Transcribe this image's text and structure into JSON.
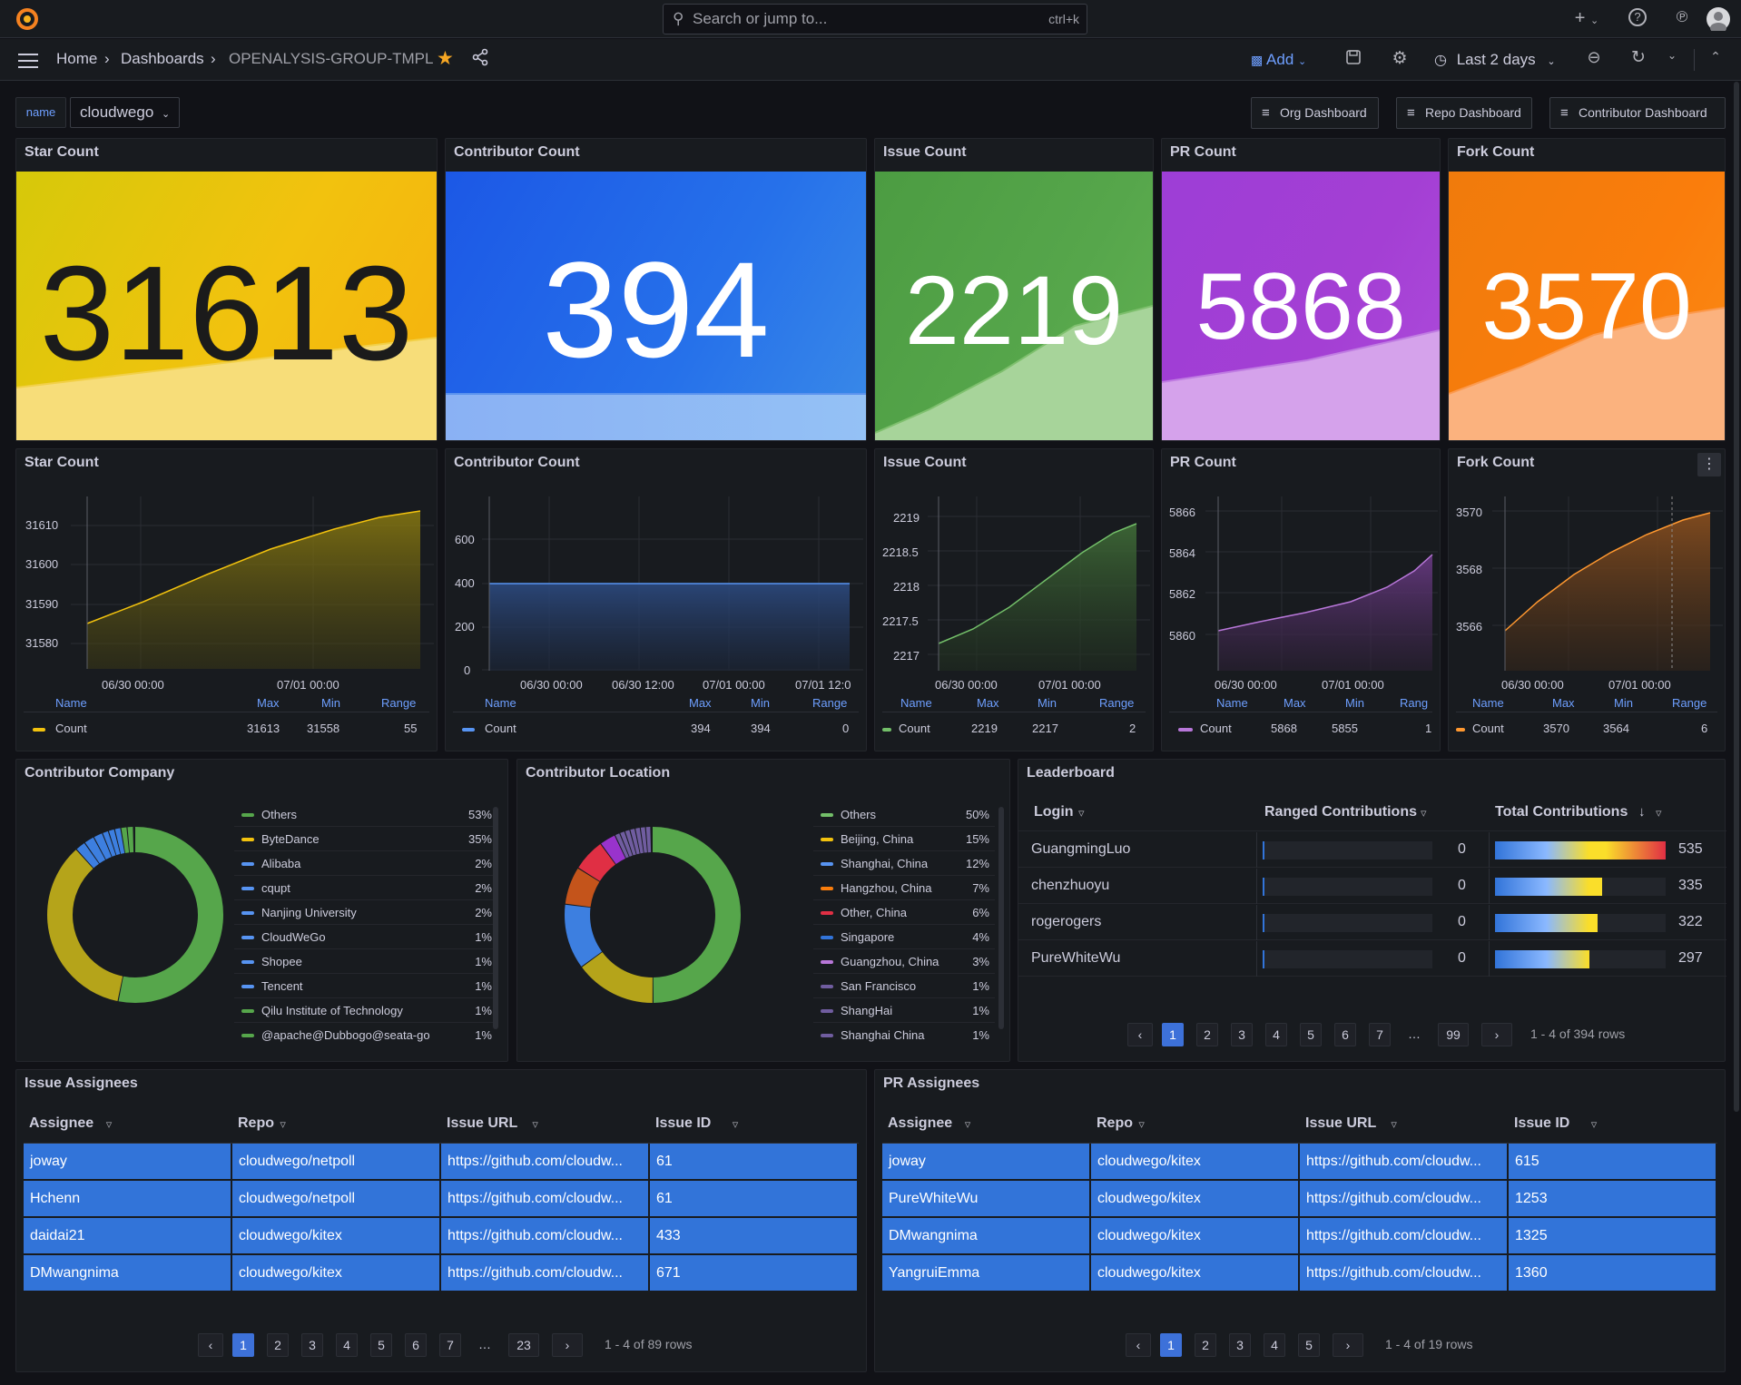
{
  "topbar": {
    "search_placeholder": "Search or jump to...",
    "search_shortcut": "ctrl+k",
    "plus_label": "+"
  },
  "breadcrumb": {
    "home": "Home",
    "dashboards": "Dashboards",
    "current": "OPENALYSIS-GROUP-TMPL"
  },
  "toolbar": {
    "add_label": "Add",
    "time_range": "Last 2 days"
  },
  "variables": {
    "name_label": "name",
    "name_value": "cloudwego"
  },
  "links": [
    "Org Dashboard",
    "Repo Dashboard",
    "Contributor Dashboard"
  ],
  "stats": [
    {
      "title": "Star Count",
      "value": "31613"
    },
    {
      "title": "Contributor Count",
      "value": "394"
    },
    {
      "title": "Issue Count",
      "value": "2219"
    },
    {
      "title": "PR Count",
      "value": "5868"
    },
    {
      "title": "Fork Count",
      "value": "3570"
    }
  ],
  "colors": {
    "yellow": "#f2c20e",
    "blue": "#1f60e8",
    "green": "#56a64b",
    "purple": "#a43fd4",
    "orange": "#fa7d0c",
    "table_cell": "#3274d9"
  },
  "timeseries": [
    {
      "title": "Star Count",
      "legend": {
        "name": "Name",
        "max_h": "Max",
        "min_h": "Min",
        "range_h": "Range",
        "series": "Count",
        "max": "31613",
        "min": "31558",
        "range": "55"
      },
      "yticks": [
        "31610",
        "31600",
        "31590",
        "31580"
      ],
      "xticks": [
        "06/30 00:00",
        "07/01 00:00"
      ]
    },
    {
      "title": "Contributor Count",
      "legend": {
        "name": "Name",
        "max_h": "Max",
        "min_h": "Min",
        "range_h": "Range",
        "series": "Count",
        "max": "394",
        "min": "394",
        "range": "0"
      },
      "yticks": [
        "600",
        "400",
        "200",
        "0"
      ],
      "xticks": [
        "06/30 00:00",
        "06/30 12:00",
        "07/01 00:00",
        "07/01 12:0"
      ]
    },
    {
      "title": "Issue Count",
      "legend": {
        "name": "Name",
        "max_h": "Max",
        "min_h": "Min",
        "range_h": "Range",
        "series": "Count",
        "max": "2219",
        "min": "2217",
        "range": "2"
      },
      "yticks": [
        "2219",
        "2218.5",
        "2218",
        "2217.5",
        "2217"
      ],
      "xticks": [
        "06/30 00:00",
        "07/01 00:00"
      ]
    },
    {
      "title": "PR Count",
      "legend": {
        "name": "Name",
        "max_h": "Max",
        "min_h": "Min",
        "range_h": "Rang",
        "series": "Count",
        "max": "5868",
        "min": "5855",
        "range": "1"
      },
      "yticks": [
        "5866",
        "5864",
        "5862",
        "5860"
      ],
      "xticks": [
        "06/30 00:00",
        "07/01 00:00"
      ]
    },
    {
      "title": "Fork Count",
      "legend": {
        "name": "Name",
        "max_h": "Max",
        "min_h": "Min",
        "range_h": "Range",
        "series": "Count",
        "max": "3570",
        "min": "3564",
        "range": "6"
      },
      "yticks": [
        "3570",
        "3568",
        "3566"
      ],
      "xticks": [
        "06/30 00:00",
        "07/01 00:00"
      ]
    }
  ],
  "company": {
    "title": "Contributor Company",
    "items": [
      {
        "name": "Others",
        "pct": "53%",
        "color": "#56a64b"
      },
      {
        "name": "ByteDance",
        "pct": "35%",
        "color": "#f2c20e"
      },
      {
        "name": "Alibaba",
        "pct": "2%",
        "color": "#5794f2"
      },
      {
        "name": "cqupt",
        "pct": "2%",
        "color": "#5794f2"
      },
      {
        "name": "Nanjing University",
        "pct": "2%",
        "color": "#5794f2"
      },
      {
        "name": "CloudWeGo",
        "pct": "1%",
        "color": "#5794f2"
      },
      {
        "name": "Shopee",
        "pct": "1%",
        "color": "#5794f2"
      },
      {
        "name": "Tencent",
        "pct": "1%",
        "color": "#5794f2"
      },
      {
        "name": "Qilu Institute of Technology",
        "pct": "1%",
        "color": "#56a64b"
      },
      {
        "name": "@apache@Dubbogo@seata-go",
        "pct": "1%",
        "color": "#56a64b"
      }
    ]
  },
  "location": {
    "title": "Contributor Location",
    "items": [
      {
        "name": "Others",
        "pct": "50%",
        "color": "#56a64b"
      },
      {
        "name": "Beijing, China",
        "pct": "15%",
        "color": "#f2c20e"
      },
      {
        "name": "Shanghai, China",
        "pct": "12%",
        "color": "#5794f2"
      },
      {
        "name": "Hangzhou, China",
        "pct": "7%",
        "color": "#fa7d0c"
      },
      {
        "name": "Other, China",
        "pct": "6%",
        "color": "#e02f44"
      },
      {
        "name": "Singapore",
        "pct": "4%",
        "color": "#3274d9"
      },
      {
        "name": "Guangzhou, China",
        "pct": "3%",
        "color": "#b877d9"
      },
      {
        "name": "San Francisco",
        "pct": "1%",
        "color": "#705da0"
      },
      {
        "name": "ShangHai",
        "pct": "1%",
        "color": "#705da0"
      },
      {
        "name": "Shanghai China",
        "pct": "1%",
        "color": "#705da0"
      }
    ]
  },
  "leaderboard": {
    "title": "Leaderboard",
    "headers": [
      "Login",
      "Ranged Contributions",
      "Total Contributions"
    ],
    "rows": [
      {
        "login": "GuangmingLuo",
        "ranged": "0",
        "total": "535",
        "frac": 1.0
      },
      {
        "login": "chenzhuoyu",
        "ranged": "0",
        "total": "335",
        "frac": 0.626
      },
      {
        "login": "rogerogers",
        "ranged": "0",
        "total": "322",
        "frac": 0.602
      },
      {
        "login": "PureWhiteWu",
        "ranged": "0",
        "total": "297",
        "frac": 0.555
      }
    ],
    "pages": [
      "1",
      "2",
      "3",
      "4",
      "5",
      "6",
      "7",
      "…",
      "99"
    ],
    "info": "1 - 4 of 394 rows"
  },
  "issue_assignees": {
    "title": "Issue Assignees",
    "headers": [
      "Assignee",
      "Repo",
      "Issue URL",
      "Issue ID"
    ],
    "rows": [
      [
        "joway",
        "cloudwego/netpoll",
        "https://github.com/cloudw...",
        "61"
      ],
      [
        "Hchenn",
        "cloudwego/netpoll",
        "https://github.com/cloudw...",
        "61"
      ],
      [
        "daidai21",
        "cloudwego/kitex",
        "https://github.com/cloudw...",
        "433"
      ],
      [
        "DMwangnima",
        "cloudwego/kitex",
        "https://github.com/cloudw...",
        "671"
      ]
    ],
    "pages": [
      "1",
      "2",
      "3",
      "4",
      "5",
      "6",
      "7",
      "…",
      "23"
    ],
    "info": "1 - 4 of 89 rows"
  },
  "pr_assignees": {
    "title": "PR Assignees",
    "headers": [
      "Assignee",
      "Repo",
      "Issue URL",
      "Issue ID"
    ],
    "rows": [
      [
        "joway",
        "cloudwego/kitex",
        "https://github.com/cloudw...",
        "615"
      ],
      [
        "PureWhiteWu",
        "cloudwego/kitex",
        "https://github.com/cloudw...",
        "1253"
      ],
      [
        "DMwangnima",
        "cloudwego/kitex",
        "https://github.com/cloudw...",
        "1325"
      ],
      [
        "YangruiEmma",
        "cloudwego/kitex",
        "https://github.com/cloudw...",
        "1360"
      ]
    ],
    "pages": [
      "1",
      "2",
      "3",
      "4",
      "5"
    ],
    "info": "1 - 4 of 19 rows"
  }
}
